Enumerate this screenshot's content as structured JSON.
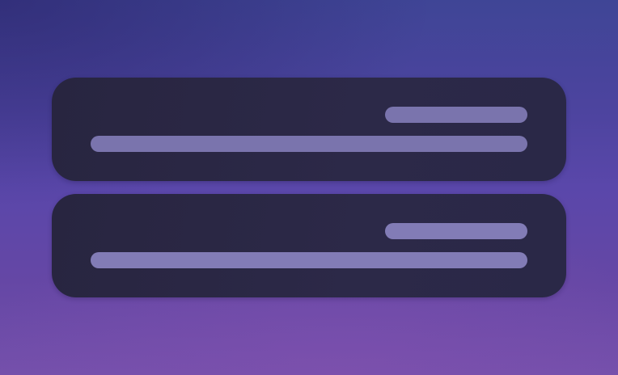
{
  "screen": {
    "theme_colors": {
      "background_top": "#3f4596",
      "background_middle": "#5a47aa",
      "background_bottom": "#7450ab",
      "panel": "#2a2747",
      "placeholder_bar": "#7a74ad"
    }
  },
  "panels": [
    {
      "name": "placeholder-card-1",
      "lines": [
        {
          "kind": "short-line"
        },
        {
          "kind": "long-line"
        }
      ]
    },
    {
      "name": "placeholder-card-2",
      "lines": [
        {
          "kind": "short-line"
        },
        {
          "kind": "long-line"
        }
      ]
    }
  ]
}
